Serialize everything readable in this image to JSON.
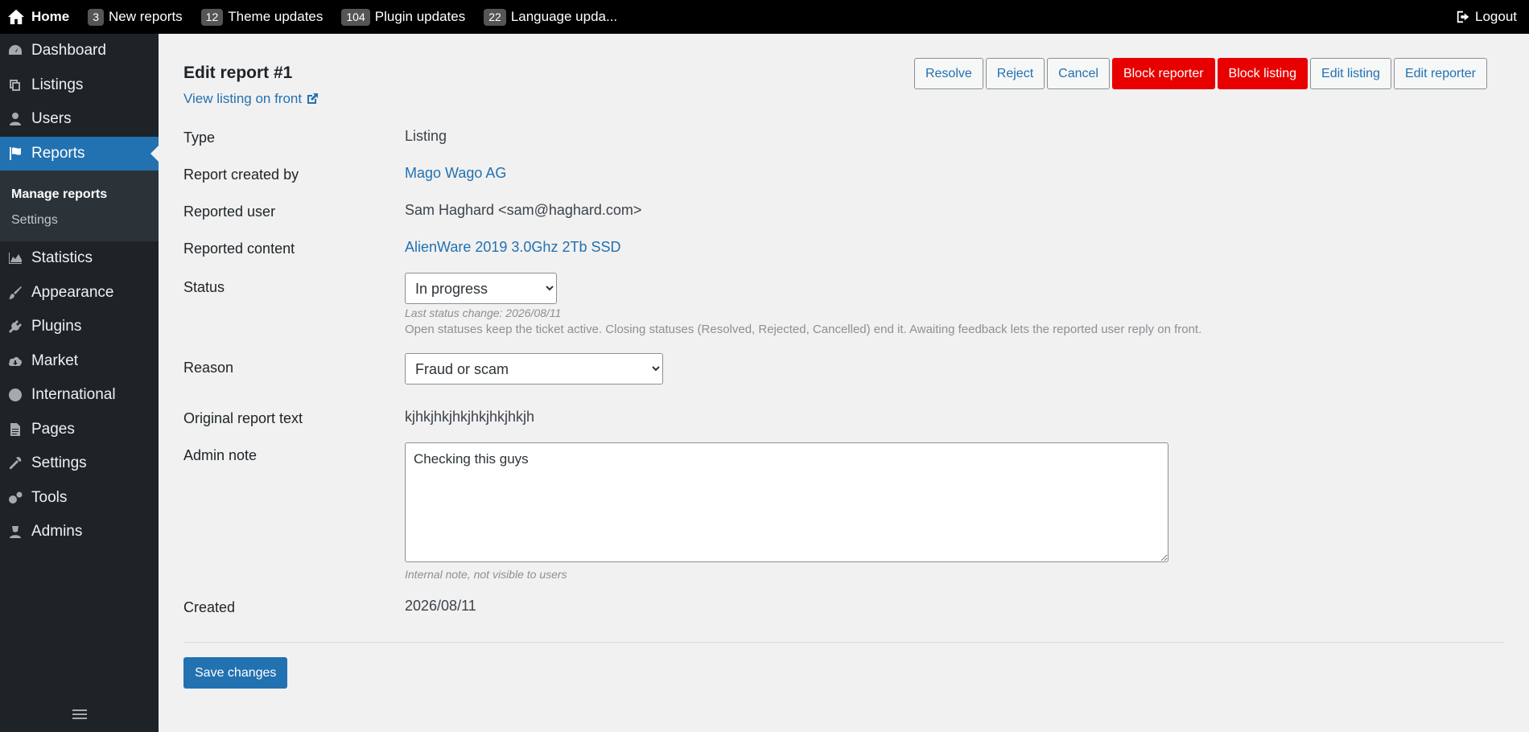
{
  "topbar": {
    "home": "Home",
    "items": [
      {
        "count": "3",
        "label": "New reports"
      },
      {
        "count": "12",
        "label": "Theme updates"
      },
      {
        "count": "104",
        "label": "Plugin updates"
      },
      {
        "count": "22",
        "label": "Language upda..."
      }
    ],
    "logout": "Logout"
  },
  "sidebar": {
    "items": [
      {
        "label": "Dashboard",
        "icon": "dashboard-icon"
      },
      {
        "label": "Listings",
        "icon": "listings-icon"
      },
      {
        "label": "Users",
        "icon": "user-icon"
      },
      {
        "label": "Reports",
        "icon": "flag-icon"
      },
      {
        "label": "Statistics",
        "icon": "chart-area-icon"
      },
      {
        "label": "Appearance",
        "icon": "brush-icon"
      },
      {
        "label": "Plugins",
        "icon": "plug-icon"
      },
      {
        "label": "Market",
        "icon": "cloud-download-icon"
      },
      {
        "label": "International",
        "icon": "globe-icon"
      },
      {
        "label": "Pages",
        "icon": "file-icon"
      },
      {
        "label": "Settings",
        "icon": "wrench-icon"
      },
      {
        "label": "Tools",
        "icon": "gears-icon"
      },
      {
        "label": "Admins",
        "icon": "admin-user-icon"
      }
    ],
    "submenu": {
      "manage_reports": "Manage reports",
      "settings": "Settings"
    }
  },
  "page": {
    "title": "Edit report #1",
    "front_link": "View listing on front",
    "actions": {
      "resolve": "Resolve",
      "reject": "Reject",
      "cancel": "Cancel",
      "block_reporter": "Block reporter",
      "block_listing": "Block listing",
      "edit_listing": "Edit listing",
      "edit_reporter": "Edit reporter"
    },
    "fields": {
      "type_label": "Type",
      "type_value": "Listing",
      "created_by_label": "Report created by",
      "created_by_value": "Mago Wago AG",
      "reported_user_label": "Reported user",
      "reported_user_value": "Sam Haghard <sam@haghard.com>",
      "reported_content_label": "Reported content",
      "reported_content_value": "AlienWare 2019 3.0Ghz 2Tb SSD",
      "status_label": "Status",
      "status_value": "In progress",
      "status_hint": "Last status change: 2026/08/11",
      "status_desc": "Open statuses keep the ticket active. Closing statuses (Resolved, Rejected, Cancelled) end it. Awaiting feedback lets the reported user reply on front.",
      "reason_label": "Reason",
      "reason_value": "Fraud or scam",
      "original_text_label": "Original report text",
      "original_text_value": "kjhkjhkjhkjhkjhkjhkjh",
      "admin_note_label": "Admin note",
      "admin_note_value": "Checking this guys",
      "admin_note_hint": "Internal note, not visible to users",
      "created_label": "Created",
      "created_value": "2026/08/11"
    },
    "save": "Save changes"
  }
}
